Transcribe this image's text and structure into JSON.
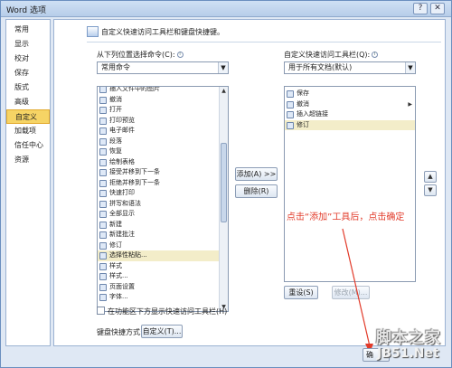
{
  "window": {
    "title": "Word 选项"
  },
  "sidebar": {
    "items": [
      {
        "label": "常用"
      },
      {
        "label": "显示"
      },
      {
        "label": "校对"
      },
      {
        "label": "保存"
      },
      {
        "label": "版式"
      },
      {
        "label": "高级"
      },
      {
        "label": "自定义",
        "active": true
      },
      {
        "label": "加载项"
      },
      {
        "label": "信任中心"
      },
      {
        "label": "资源"
      }
    ]
  },
  "header": {
    "title": "自定义快速访问工具栏和键盘快捷键。"
  },
  "left_panel": {
    "choose_label": "从下列位置选择命令(C):",
    "choose_value": "常用命令",
    "commands": [
      {
        "label": "插入文件中的图片",
        "icon": "picture-icon"
      },
      {
        "label": "撤消",
        "icon": "undo-icon",
        "submenu": true
      },
      {
        "label": "打开",
        "icon": "folder-open-icon"
      },
      {
        "label": "打印预览",
        "icon": "print-preview-icon"
      },
      {
        "label": "电子邮件",
        "icon": "email-icon"
      },
      {
        "label": "段落",
        "icon": "paragraph-icon"
      },
      {
        "label": "恢复",
        "icon": "redo-icon"
      },
      {
        "label": "绘制表格",
        "icon": "draw-table-icon"
      },
      {
        "label": "接受并移到下一条",
        "icon": "accept-change-icon"
      },
      {
        "label": "拒绝并移到下一条",
        "icon": "reject-change-icon"
      },
      {
        "label": "快速打印",
        "icon": "quick-print-icon"
      },
      {
        "label": "拼写和语法",
        "icon": "spelling-icon"
      },
      {
        "label": "全部显示",
        "icon": "show-all-icon"
      },
      {
        "label": "新建",
        "icon": "new-doc-icon"
      },
      {
        "label": "新建批注",
        "icon": "new-comment-icon"
      },
      {
        "label": "修订",
        "icon": "track-changes-icon"
      },
      {
        "label": "选择性粘贴...",
        "icon": "paste-special-icon",
        "selected": true
      },
      {
        "label": "样式",
        "icon": "style-icon",
        "submenu": true
      },
      {
        "label": "样式...",
        "icon": "styles-icon"
      },
      {
        "label": "页面设置",
        "icon": "page-setup-icon"
      },
      {
        "label": "字体...",
        "icon": "font-icon"
      }
    ],
    "ribbon_checkbox_label": "在功能区下方显示快速访问工具栏(H)",
    "keyboard_label": "键盘快捷方式:",
    "customize_button": "自定义(T)..."
  },
  "middle": {
    "add_button": "添加(A) >>",
    "remove_button": "删除(R)"
  },
  "right_panel": {
    "qat_label": "自定义快速访问工具栏(Q):",
    "qat_value": "用于所有文档(默认)",
    "toolbar_items": [
      {
        "label": "保存",
        "icon": "save-icon"
      },
      {
        "label": "撤消",
        "icon": "undo-icon",
        "submenu": true
      },
      {
        "label": "插入超链接",
        "icon": "hyperlink-icon"
      },
      {
        "label": "修订",
        "icon": "track-changes-icon",
        "selected": true
      }
    ],
    "reset_button": "重设(S)",
    "modify_button": "修改(M)..."
  },
  "annotation": "点击“添加”工具后，点击确定",
  "ok_button": "确",
  "watermark": {
    "line1": "脚本之家",
    "line2": "JB51.Net"
  }
}
